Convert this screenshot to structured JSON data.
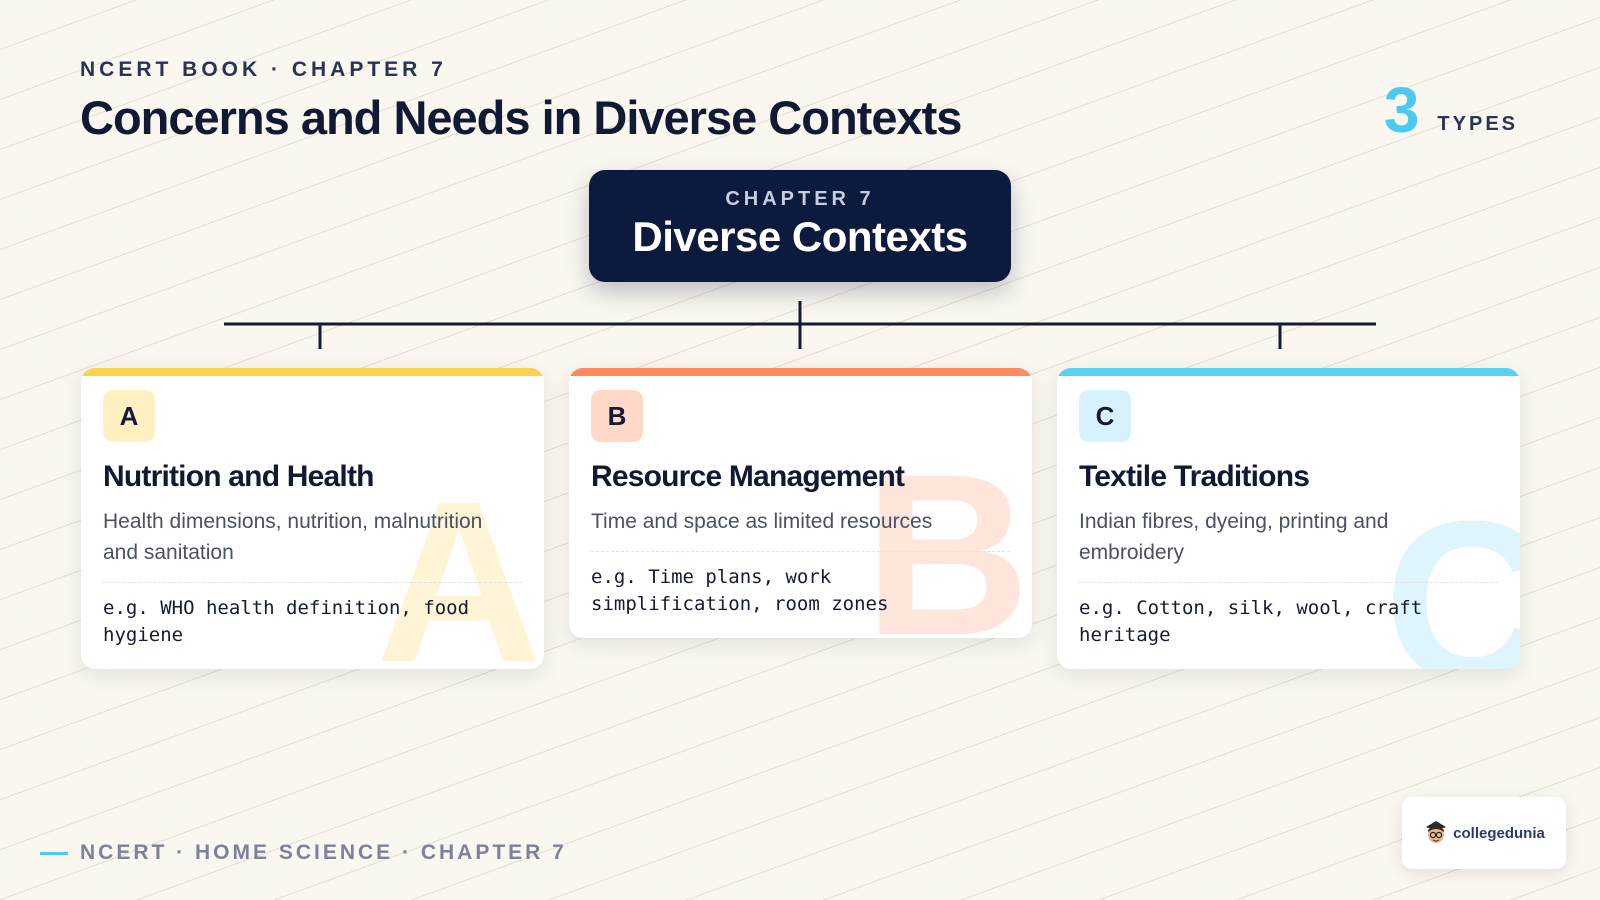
{
  "header": {
    "eyebrow": "NCERT BOOK · CHAPTER 7",
    "title": "Concerns and Needs in Diverse Contexts",
    "count": "3",
    "count_label": "TYPES"
  },
  "root": {
    "kicker": "CHAPTER 7",
    "title": "Diverse Contexts"
  },
  "cards": [
    {
      "letter": "A",
      "title": "Nutrition and Health",
      "description": "Health dimensions, nutrition, malnutrition and sanitation",
      "example": "e.g. WHO health definition, food hygiene",
      "accent": "#fdd24f",
      "badge_bg": "#fff0c2",
      "watermark_color": "#fff4d6"
    },
    {
      "letter": "B",
      "title": "Resource Management",
      "description": "Time and space as limited resources",
      "example": "e.g. Time plans, work simplification, room zones",
      "accent": "#ff8a5c",
      "badge_bg": "#ffd8c8",
      "watermark_color": "#ffe6dc"
    },
    {
      "letter": "C",
      "title": "Textile Traditions",
      "description": "Indian fibres, dyeing, printing and embroidery",
      "example": "e.g. Cotton, silk, wool, craft heritage",
      "accent": "#5bd0f5",
      "badge_bg": "#d6f3fd",
      "watermark_color": "#def5fd"
    }
  ],
  "footer": {
    "text": "NCERT · HOME SCIENCE · CHAPTER 7"
  },
  "logo": {
    "text": "collegedunia"
  },
  "colors": {
    "navy": "#0c1a3e",
    "accent_blue": "#4cc9f0"
  }
}
